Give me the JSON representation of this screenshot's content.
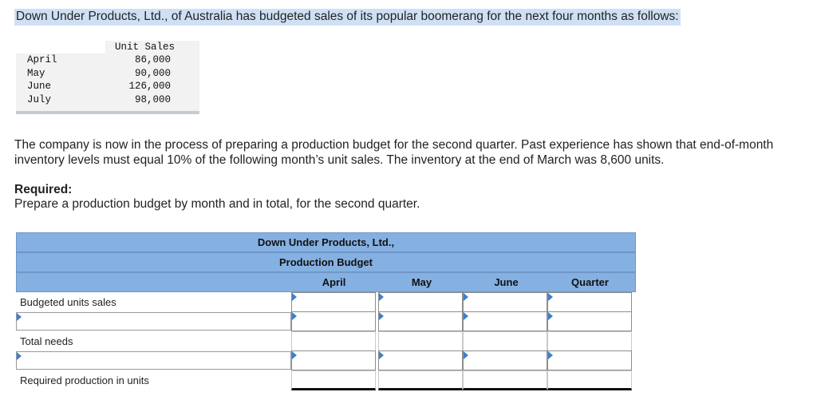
{
  "intro": "Down Under Products, Ltd., of Australia has budgeted sales of its popular boomerang for the next four months as follows:",
  "sales_table": {
    "header": "Unit Sales",
    "rows": [
      {
        "month": "April",
        "value": "86,000"
      },
      {
        "month": "May",
        "value": "90,000"
      },
      {
        "month": "June",
        "value": "126,000"
      },
      {
        "month": "July",
        "value": "98,000"
      }
    ]
  },
  "paragraph": "The company is now in the process of preparing a production budget for the second quarter. Past experience has shown that end-of-month inventory levels must equal 10% of the following month’s unit sales. The inventory at the end of March was 8,600 units.",
  "required": {
    "title": "Required:",
    "text": "Prepare a production budget by month and in total, for the second quarter."
  },
  "budget": {
    "company": "Down Under Products, Ltd.,",
    "title": "Production Budget",
    "columns": [
      "April",
      "May",
      "June",
      "Quarter"
    ],
    "row_labels": {
      "budgeted_units_sales": "Budgeted units sales",
      "total_needs": "Total needs",
      "required_production": "Required production in units"
    }
  },
  "colors": {
    "highlight": "#cfe0f4",
    "header_band": "#85b0e2",
    "input_marker": "#3f7fcc"
  }
}
